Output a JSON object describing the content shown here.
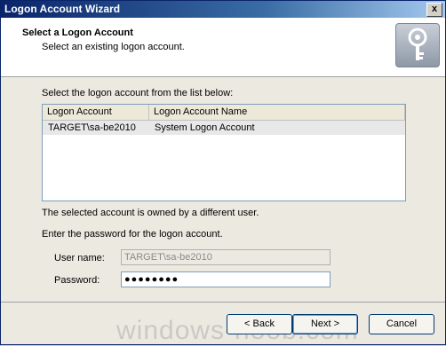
{
  "window": {
    "title": "Logon Account Wizard",
    "close_glyph": "x"
  },
  "header": {
    "title": "Select a Logon Account",
    "subtitle": "Select an existing logon account.",
    "icon": "key-icon"
  },
  "list_section": {
    "instruction": "Select the logon account from the list below:",
    "columns": [
      "Logon Account",
      "Logon Account Name"
    ],
    "rows": [
      {
        "account": "TARGET\\sa-be2010",
        "name": "System Logon Account"
      }
    ]
  },
  "status": {
    "owned_message": "The selected account is owned by a different user.",
    "password_prompt": "Enter the password for the logon account."
  },
  "form": {
    "username_label": "User name:",
    "username_value": "TARGET\\sa-be2010",
    "password_label": "Password:",
    "password_value": "●●●●●●●●"
  },
  "buttons": {
    "back": "< Back",
    "next": "Next >",
    "cancel": "Cancel"
  },
  "watermark": "windows-noob.com"
}
